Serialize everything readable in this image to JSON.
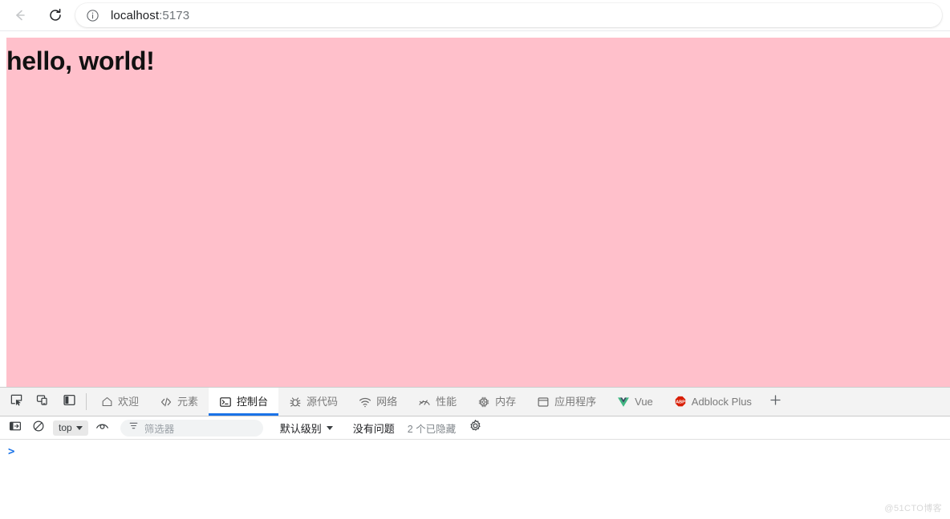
{
  "browser": {
    "back_icon": "arrow-left-icon",
    "reload_icon": "reload-icon",
    "site_info_icon": "info-circle-icon",
    "url_host": "localhost",
    "url_port": ":5173",
    "url_full": "localhost:5173"
  },
  "page": {
    "heading": "hello, world!",
    "background_color": "#ffc0cb",
    "text_color": "#111111"
  },
  "devtools": {
    "dock_buttons": [
      {
        "name": "inspect-element",
        "icon": "inspect-cursor-icon"
      },
      {
        "name": "device-toolbar",
        "icon": "device-toggle-icon"
      },
      {
        "name": "dock-side",
        "icon": "dock-panel-icon"
      }
    ],
    "tabs": [
      {
        "label": "欢迎",
        "icon": "home-icon",
        "active": false
      },
      {
        "label": "元素",
        "icon": "code-brackets-icon",
        "active": false
      },
      {
        "label": "控制台",
        "icon": "console-terminal-icon",
        "active": true
      },
      {
        "label": "源代码",
        "icon": "bug-icon",
        "active": false
      },
      {
        "label": "网络",
        "icon": "wifi-icon",
        "active": false
      },
      {
        "label": "性能",
        "icon": "performance-gauge-icon",
        "active": false
      },
      {
        "label": "内存",
        "icon": "memory-chip-icon",
        "active": false
      },
      {
        "label": "应用程序",
        "icon": "application-window-icon",
        "active": false
      },
      {
        "label": "Vue",
        "icon": "vue-logo-icon",
        "active": false
      },
      {
        "label": "Adblock Plus",
        "icon": "adblock-plus-icon",
        "active": false
      }
    ],
    "more_tabs_label": "+",
    "active_tab_underline_color": "#1a73e8",
    "console_toolbar": {
      "sidebar_toggle_icon": "console-sidebar-icon",
      "clear_console_icon": "clear-console-icon",
      "context_value": "top",
      "live_expression_icon": "eye-icon",
      "filter_icon": "filter-funnel-icon",
      "filter_placeholder": "筛选器",
      "filter_value": "",
      "level_label": "默认级别",
      "issues_label": "没有问题",
      "hidden_label": "2 个已隐藏",
      "settings_icon": "gear-icon"
    },
    "console_prompt": ">",
    "console_input_value": ""
  },
  "watermark": "@51CTO博客"
}
